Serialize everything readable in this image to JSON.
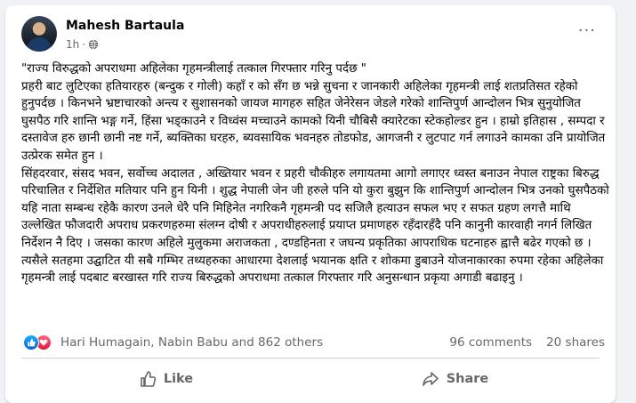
{
  "post": {
    "author": "Mahesh Bartaula",
    "time": "1h",
    "privacy_icon": "globe-icon",
    "more_label": "···",
    "body": "\"राज्य विरुद्धको अपराधमा  अहिलेका गृहमन्त्रीलाई तत्काल गिरफ्तार गरिनु पर्दछ \"\nप्रहरी बाट लुटिएका हतियारहरु (बन्दुक र गोली) कहाँ र को  सँग छ भन्ने सुचना र जानकारी अहिलेका गृहमन्त्री लाई शतप्रतिसत रहेको हुनुपर्दछ । किनभने भ्रष्टाचारको अन्त्य र सुशासनको जायज मागहरु सहित जेनेरेसन जेडले गरेको शान्तिपुर्ण आन्दोलन भित्र सुनुयोजित घुसपैठ गरि शान्ति भङ्ग गर्ने,  हिंसा भड्काउने र विध्वंस मच्चाउने कामको यिनी चौबिसै क्यारेटका स्टेकहोल्डर हुन । हाम्रो इतिहास , सम्पदा  र दस्तावेज हरु छानी छानी नष्ट गर्ने,  ब्यक्तिका घरहरु, ब्यवसायिक भवनहरु तोडफोड, आगजनी र लुटपाट गर्न लगाउने कामका उनि प्रायोजित उत्प्रेरक समेत हुन ।\nसिंहदरवार, संसद भवन,  सर्वोच्च अदालत  , अख्तियार भवन र प्रहरी चौकीहरु लगायतमा आगो लगाएर ध्वस्त बनाउन नेपाल राष्ट्रका बिरुद्ध परिचालित र निर्देशित मतियार पनि हुन  यिनी । शुद्ध नेपाली जेन जी हरुले पनि यो कुरा बुझुन कि शान्तिपुर्ण आन्दोलन भित्र उनको घुसपैठको यहि नाता सम्बन्ध रहेकै कारण उनले  धेरै पनि मिहिनेत नगरिकनै गृहमन्त्री पद  सजिलै हत्याउन सफल भए र सफत ग्रहण लगत्तै माथि उल्लेखित फौजदारी अपराध प्रकरणहरुमा संलग्न दोषी र अपराधीहरुलाई प्रयाप्त प्रमाणहरु रहँदारहँदै पनि कानुनी कारवाही नगर्न लिखित निर्देशन नै दिए । जसका कारण अहिले मुलुकमा अराजकता , दण्डहिनता र जघन्य प्रकृतिका आपराधिक घटनाहरु ह्वात्तै बढेर गएको छ ।\nत्यसैले सतहमा उद्घाटित यी सबै गम्भिर तथ्यहरुका आधारमा देशलाई भयानक क्षति र शोकमा डुबाउने योजनाकारका रुपमा रहेका अहिलेका गृहमन्त्री लाई पदबाट बरखास्त गरि राज्य बिरुद्धको अपराधमा  तत्काल गिरफ्तार गरि अनुसन्धान प्रकृया अगाडी बढाइनु ।"
  },
  "reactions": {
    "icons": [
      "like-reaction-icon",
      "love-reaction-icon"
    ],
    "names": "Hari Humagain, Nabin Babu and 862 others",
    "comments": "96 comments",
    "shares": "20 shares"
  },
  "actions": {
    "like_label": "Like",
    "share_label": "Share"
  },
  "colors": {
    "background": "#f0f2f5",
    "card": "#ffffff",
    "secondary_text": "#65676b",
    "like_blue": "#0866ff",
    "love_red": "#e61739"
  }
}
